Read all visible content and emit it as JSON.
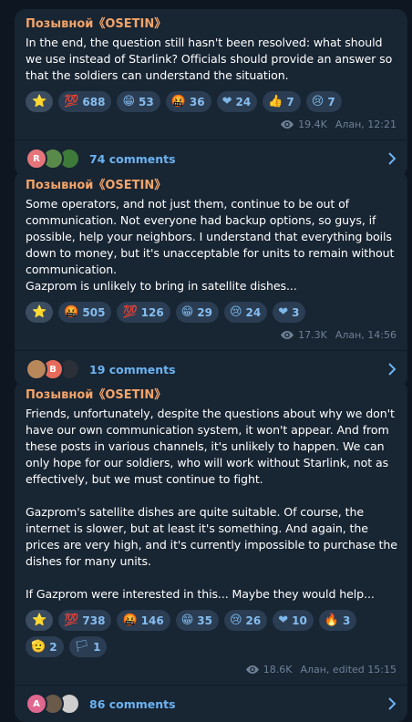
{
  "posts": [
    {
      "author": "Позывной《OSETIN》",
      "text": "In the end, the question still hasn't been resolved: what should we use instead of Starlink? Officials should provide an answer so that the soldiers can understand the situation.",
      "reactions": [
        {
          "emoji": "⭐",
          "count": ""
        },
        {
          "emoji": "💯",
          "count": "688"
        },
        {
          "emoji": "😁",
          "count": "53"
        },
        {
          "emoji": "🤬",
          "count": "36"
        },
        {
          "emoji": "❤",
          "count": "24"
        },
        {
          "emoji": "👍",
          "count": "7"
        },
        {
          "emoji": "😢",
          "count": "7"
        }
      ],
      "views": "19.4K",
      "signature": "Алан, 12:21",
      "comments": "74 comments"
    },
    {
      "author": "Позывной《OSETIN》",
      "text": "Some operators, and not just them, continue to be out of communication. Not everyone had backup options, so guys, if possible, help your neighbors. I understand that everything boils down to money, but it's unacceptable for units to remain without communication.\nGazprom is unlikely to bring in satellite dishes...",
      "reactions": [
        {
          "emoji": "⭐",
          "count": ""
        },
        {
          "emoji": "🤬",
          "count": "505"
        },
        {
          "emoji": "💯",
          "count": "126"
        },
        {
          "emoji": "😁",
          "count": "29"
        },
        {
          "emoji": "😢",
          "count": "24"
        },
        {
          "emoji": "❤",
          "count": "3"
        }
      ],
      "views": "17.3K",
      "signature": "Алан, 14:56",
      "comments": "19 comments"
    },
    {
      "author": "Позывной《OSETIN》",
      "text": "Friends, unfortunately, despite the questions about why we don't have our own communication system, it won't appear. And from these posts in various channels, it's unlikely to happen. We can only hope for our soldiers, who will work without Starlink, not as effectively, but we must continue to fight.\n\nGazprom's satellite dishes are quite suitable. Of course, the internet is slower, but at least it's something. And again, the prices are very high, and it's currently impossible to purchase the dishes for many units.\n\nIf Gazprom were interested in this... Maybe they would help...",
      "reactions": [
        {
          "emoji": "⭐",
          "count": ""
        },
        {
          "emoji": "💯",
          "count": "738"
        },
        {
          "emoji": "🤬",
          "count": "146"
        },
        {
          "emoji": "😁",
          "count": "35"
        },
        {
          "emoji": "😢",
          "count": "26"
        },
        {
          "emoji": "❤",
          "count": "10"
        },
        {
          "emoji": "🔥",
          "count": "3"
        },
        {
          "emoji": "🫡",
          "count": "2"
        },
        {
          "emoji": "🏳",
          "count": "1"
        }
      ],
      "views": "18.6K",
      "signature": "Алан, edited 15:15",
      "comments": "86 comments"
    }
  ],
  "avatars": [
    [
      {
        "letter": "R",
        "color": "#e5757b"
      },
      {
        "letter": "",
        "color": "#5a8a4a"
      },
      {
        "letter": "",
        "color": "#3e7a3a"
      }
    ],
    [
      {
        "letter": "",
        "color": "#b8875a"
      },
      {
        "letter": "B",
        "color": "#e66b5b"
      },
      {
        "letter": "",
        "color": "#2a2f38"
      }
    ],
    [
      {
        "letter": "A",
        "color": "#e06890"
      },
      {
        "letter": "",
        "color": "#6a5a4a"
      },
      {
        "letter": "",
        "color": "#cfcfcf"
      }
    ]
  ],
  "colors": {
    "background": "#0e1621",
    "bubble": "#182533",
    "author": "#f3a46a",
    "link": "#6cb3f1",
    "meta": "#6e8196",
    "reaction_bg": "#2b3d52"
  }
}
